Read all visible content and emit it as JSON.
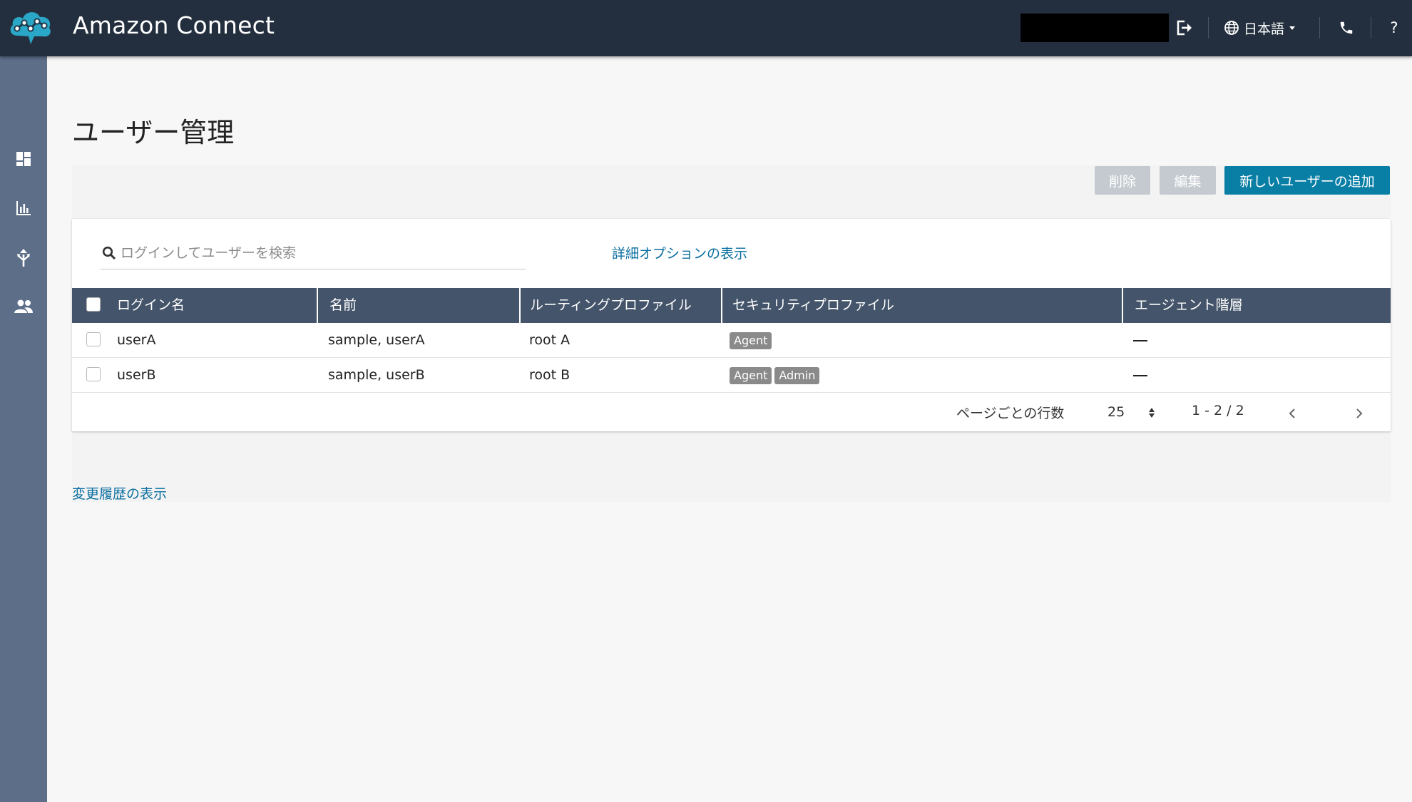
{
  "header": {
    "app_title": "Amazon Connect",
    "language_label": "日本語",
    "help_label": "?"
  },
  "sidebar": {
    "items": [
      {
        "name": "dashboard-icon"
      },
      {
        "name": "metrics-icon"
      },
      {
        "name": "routing-icon"
      },
      {
        "name": "users-icon"
      }
    ]
  },
  "page": {
    "title": "ユーザー管理"
  },
  "toolbar": {
    "delete_label": "削除",
    "edit_label": "編集",
    "add_label": "新しいユーザーの追加"
  },
  "search": {
    "value": "",
    "placeholder": "ログインしてユーザーを検索",
    "advanced_link": "詳細オプションの表示"
  },
  "table": {
    "columns": [
      "ログイン名",
      "名前",
      "ルーティングプロファイル",
      "セキュリティプロファイル",
      "エージェント階層"
    ],
    "rows": [
      {
        "login": "userA",
        "name": "sample, userA",
        "routing": "root A",
        "security": [
          "Agent"
        ],
        "hierarchy": "—"
      },
      {
        "login": "userB",
        "name": "sample, userB",
        "routing": "root B",
        "security": [
          "Agent",
          "Admin"
        ],
        "hierarchy": "—"
      }
    ]
  },
  "pagination": {
    "rows_per_page_label": "ページごとの行数",
    "rows_per_page": "25",
    "range": "1 - 2 / 2"
  },
  "footer": {
    "history_link": "変更履歴の表示"
  },
  "colors": {
    "topbar": "#232f3e",
    "sidebar": "#5d6e89",
    "table_header": "#44546a",
    "primary_button": "#0a7fa6",
    "link": "#0a6ea0"
  }
}
